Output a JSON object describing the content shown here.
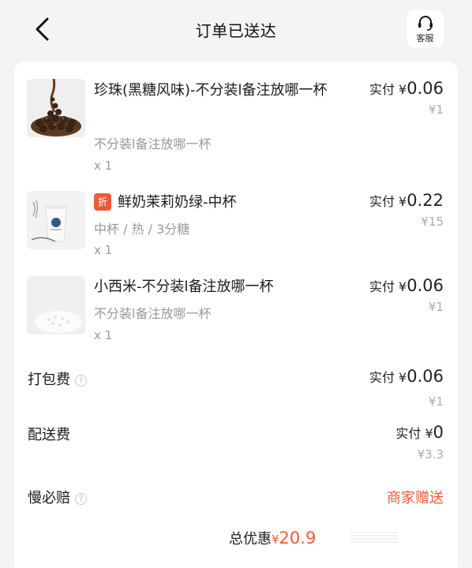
{
  "header": {
    "title": "订单已送达",
    "service_label": "客服"
  },
  "items": [
    {
      "name": "珍珠(黑糖风味)-不分装l备注放哪一杯",
      "badge": "",
      "spec": "不分装l备注放哪一杯",
      "qty": "x 1",
      "paid_label": "实付",
      "currency": "¥",
      "paid_value": "0.06",
      "original_price": "¥1",
      "thumb_icon": "pearls-image"
    },
    {
      "name": "鲜奶茉莉奶绿-中杯",
      "badge": "折",
      "spec": "中杯 / 热 / 3分糖",
      "qty": "x 1",
      "paid_label": "实付",
      "currency": "¥",
      "paid_value": "0.22",
      "original_price": "¥15",
      "thumb_icon": "milk-tea-cup-image"
    },
    {
      "name": "小西米-不分装l备注放哪一杯",
      "badge": "",
      "spec": "不分装l备注放哪一杯",
      "qty": "x 1",
      "paid_label": "实付",
      "currency": "¥",
      "paid_value": "0.06",
      "original_price": "¥1",
      "thumb_icon": "sago-image"
    }
  ],
  "fees": {
    "packing": {
      "label": "打包费",
      "help": "?",
      "paid_label": "实付",
      "currency": "¥",
      "paid_value": "0.06",
      "original_price": "¥1"
    },
    "delivery": {
      "label": "配送费",
      "paid_label": "实付",
      "currency": "¥",
      "paid_value": "0",
      "original_price": "¥3.3"
    },
    "late_comp": {
      "label": "慢必赔",
      "help": "?",
      "value": "商家赠送"
    }
  },
  "total_discount": {
    "label": "总优惠",
    "currency": "¥",
    "value": "20.9"
  },
  "colors": {
    "accent": "#ef5a36",
    "muted": "#999999",
    "background": "#f4f4f4"
  },
  "icons": [
    "chevron-left-icon",
    "headset-icon",
    "help-icon"
  ]
}
